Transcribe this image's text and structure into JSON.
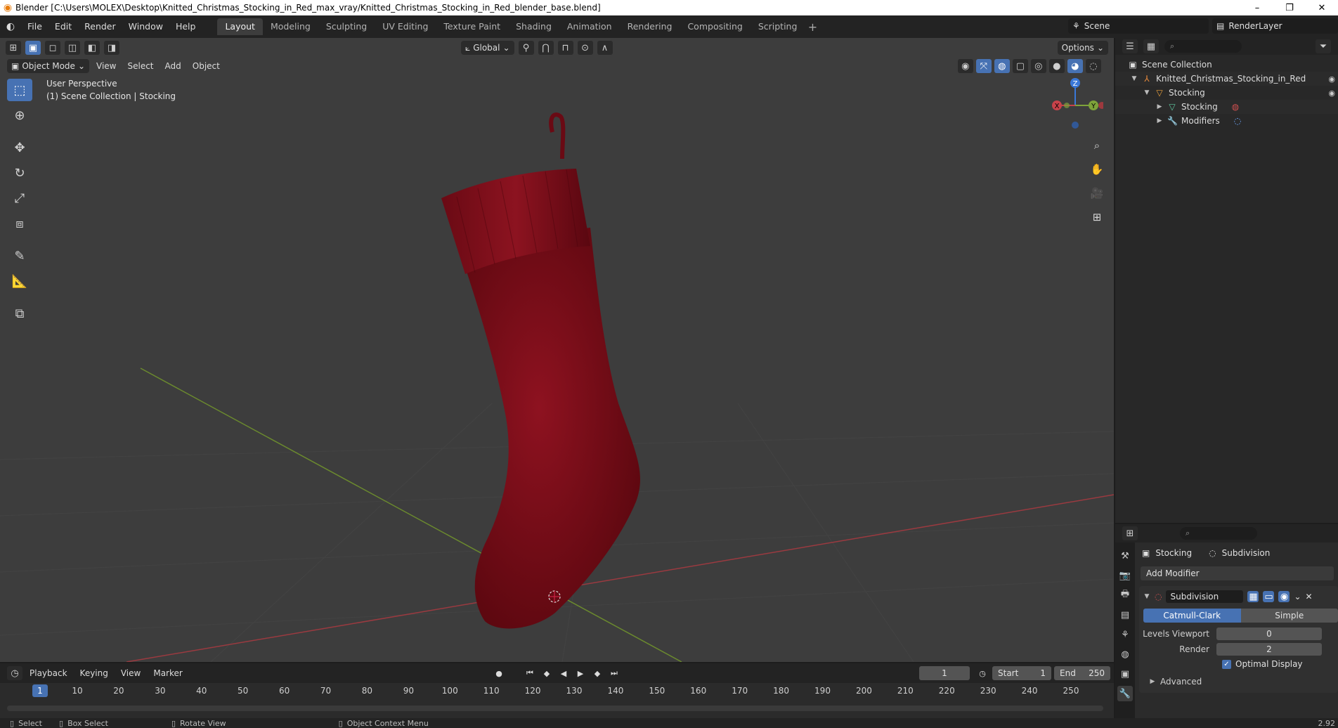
{
  "window": {
    "title": "Blender [C:\\Users\\MOLEX\\Desktop\\Knitted_Christmas_Stocking_in_Red_max_vray/Knitted_Christmas_Stocking_in_Red_blender_base.blend]",
    "minimize": "–",
    "maximize": "❐",
    "close": "✕"
  },
  "menu": {
    "items": [
      "File",
      "Edit",
      "Render",
      "Window",
      "Help"
    ]
  },
  "workspaces": {
    "tabs": [
      "Layout",
      "Modeling",
      "Sculpting",
      "UV Editing",
      "Texture Paint",
      "Shading",
      "Animation",
      "Rendering",
      "Compositing",
      "Scripting"
    ],
    "active": "Layout",
    "add": "+"
  },
  "scene": {
    "name": "Scene",
    "render_layer": "RenderLayer"
  },
  "viewport": {
    "mode": "Object Mode",
    "menus": [
      "View",
      "Select",
      "Add",
      "Object"
    ],
    "transform_orientation": "Global",
    "options": "Options",
    "info_line1": "User Perspective",
    "info_line2": "(1) Scene Collection | Stocking",
    "gizmo": {
      "x": "X",
      "y": "Y",
      "z": "Z"
    }
  },
  "outliner": {
    "search_placeholder": "",
    "rows": [
      {
        "label": "Scene Collection",
        "icon": "collection-icon"
      },
      {
        "label": "Knitted_Christmas_Stocking_in_Red",
        "icon": "object-icon"
      },
      {
        "label": "Stocking",
        "icon": "mesh-object-icon"
      },
      {
        "label": "Stocking",
        "icon": "mesh-data-icon"
      },
      {
        "label": "Modifiers",
        "icon": "wrench-icon"
      }
    ]
  },
  "properties": {
    "crumb_object": "Stocking",
    "crumb_modifier": "Subdivision",
    "add_modifier": "Add Modifier",
    "modifier_name": "Subdivision",
    "mode_on": "Catmull-Clark",
    "mode_off": "Simple",
    "levels_viewport_label": "Levels Viewport",
    "levels_viewport_value": "0",
    "render_label": "Render",
    "render_value": "2",
    "optimal_display": "Optimal Display",
    "advanced": "Advanced"
  },
  "timeline": {
    "menus": [
      "Playback",
      "Keying",
      "View",
      "Marker"
    ],
    "current_frame": "1",
    "start_label": "Start",
    "start_value": "1",
    "end_label": "End",
    "end_value": "250",
    "ticks": [
      "1",
      "10",
      "20",
      "30",
      "40",
      "50",
      "60",
      "70",
      "80",
      "90",
      "100",
      "110",
      "120",
      "130",
      "140",
      "150",
      "160",
      "170",
      "180",
      "190",
      "200",
      "210",
      "220",
      "230",
      "240",
      "250"
    ]
  },
  "status": {
    "select": "Select",
    "box_select": "Box Select",
    "rotate_view": "Rotate View",
    "context_menu": "Object Context Menu",
    "version": "2.92"
  },
  "colors": {
    "accent": "#4772b3",
    "stocking": "#7a0c16",
    "x_axis": "#c8424a",
    "y_axis": "#7ea33a",
    "z_axis": "#3a78d8"
  }
}
